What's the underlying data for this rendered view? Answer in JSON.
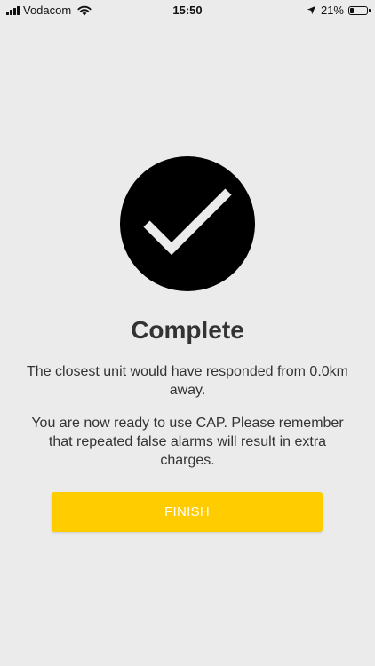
{
  "status_bar": {
    "carrier": "Vodacom",
    "time": "15:50",
    "battery_percent": "21%",
    "battery_level": 0.21,
    "icons": [
      "signal-icon",
      "wifi-icon",
      "location-arrow-icon",
      "battery-icon"
    ]
  },
  "main": {
    "icon": "checkmark-icon",
    "title": "Complete",
    "message_1": "The closest unit would have responded from 0.0km away.",
    "message_2": "You are now ready to use CAP. Please remember that repeated false alarms will result in extra charges.",
    "finish_label": "FINISH"
  },
  "colors": {
    "background": "#ebebeb",
    "accent": "#ffcc00",
    "circle": "#000000",
    "text": "#333333"
  }
}
